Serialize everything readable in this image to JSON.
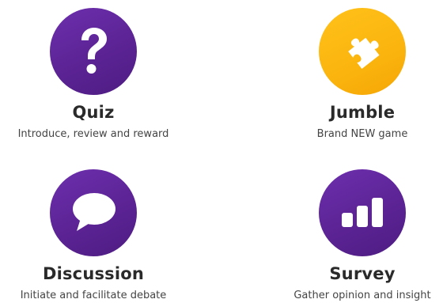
{
  "tiles": [
    {
      "title": "Quiz",
      "description": "Introduce, review and reward",
      "icon": "question-mark-icon",
      "color": "#5b2394"
    },
    {
      "title": "Jumble",
      "description": "Brand NEW game",
      "icon": "puzzle-piece-icon",
      "color": "#fbb40e"
    },
    {
      "title": "Discussion",
      "description": "Initiate and facilitate debate",
      "icon": "speech-bubble-icon",
      "color": "#5b2394"
    },
    {
      "title": "Survey",
      "description": "Gather opinion and insight",
      "icon": "bar-chart-icon",
      "color": "#5b2394"
    }
  ]
}
